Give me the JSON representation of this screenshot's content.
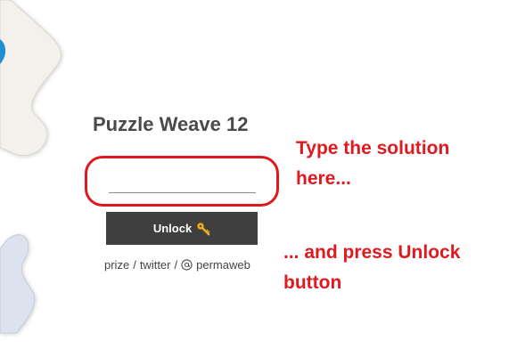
{
  "page": {
    "title": "Puzzle Weave 12"
  },
  "form": {
    "solution_value": "",
    "unlock_label": "Unlock"
  },
  "links": {
    "prize": "prize",
    "twitter": "twitter",
    "permaweb": "permaweb",
    "separator": "/"
  },
  "annotations": {
    "type_line1": "Type the solution",
    "type_line2": "here...",
    "press_line1": "... and press Unlock",
    "press_line2": "button"
  },
  "colors": {
    "annotation": "#e0191f",
    "button_bg": "#3f3f3f",
    "title": "#4a4a4a",
    "puzzle_cream": "#f4f1ec",
    "puzzle_blue": "#dce3ee"
  },
  "icons": {
    "unlock": "key-icon",
    "permaweb": "at-sign-circle-icon"
  }
}
